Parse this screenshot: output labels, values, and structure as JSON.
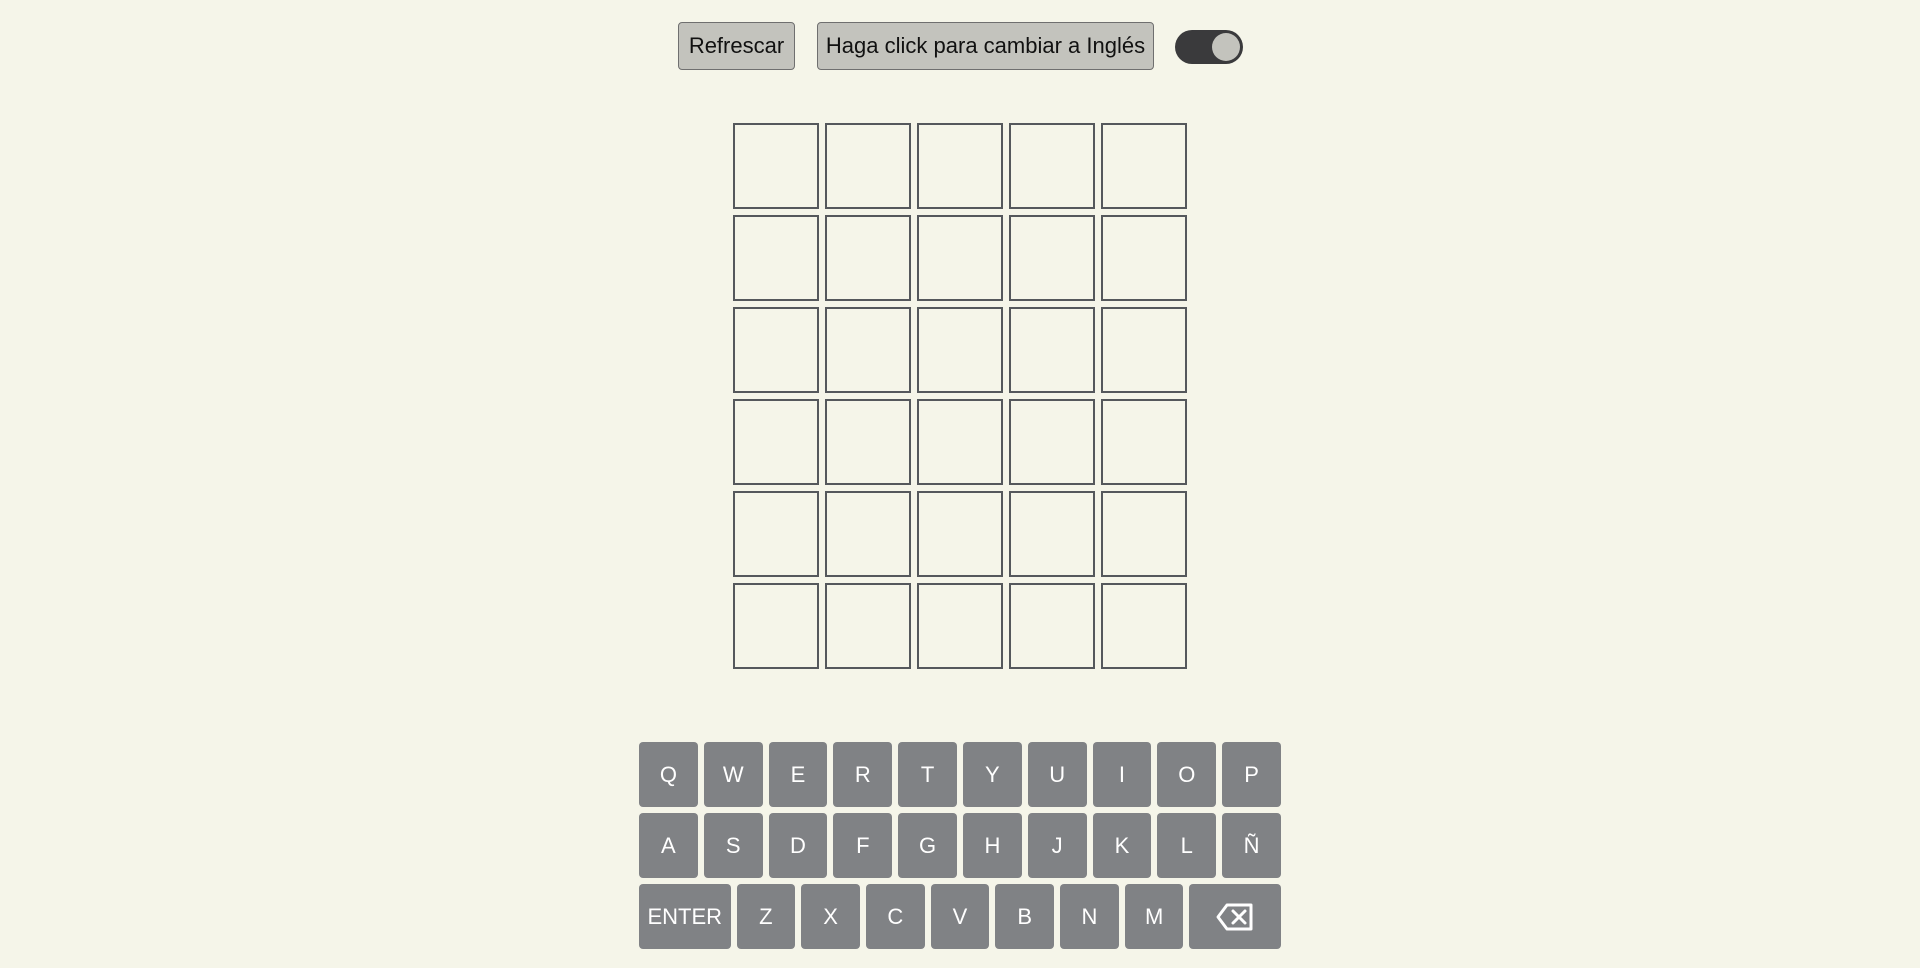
{
  "controls": {
    "refresh_label": "Refrescar",
    "language_label": "Haga click para cambiar a Inglés",
    "dark_mode_toggle": {
      "on": true
    }
  },
  "board": {
    "rows": [
      [
        "",
        "",
        "",
        "",
        ""
      ],
      [
        "",
        "",
        "",
        "",
        ""
      ],
      [
        "",
        "",
        "",
        "",
        ""
      ],
      [
        "",
        "",
        "",
        "",
        ""
      ],
      [
        "",
        "",
        "",
        "",
        ""
      ],
      [
        "",
        "",
        "",
        "",
        ""
      ]
    ]
  },
  "keyboard": {
    "row1": [
      "Q",
      "W",
      "E",
      "R",
      "T",
      "Y",
      "U",
      "I",
      "O",
      "P"
    ],
    "row2": [
      "A",
      "S",
      "D",
      "F",
      "G",
      "H",
      "J",
      "K",
      "L",
      "Ñ"
    ],
    "row3": [
      "ENTER",
      "Z",
      "X",
      "C",
      "V",
      "B",
      "N",
      "M"
    ],
    "backspace_icon": "backspace-icon"
  },
  "colors": {
    "background": "#f5f5e9",
    "key": "#808285",
    "tile_border": "#55585c",
    "button": "#c3c3bd",
    "toggle": "#3a3a3c"
  }
}
